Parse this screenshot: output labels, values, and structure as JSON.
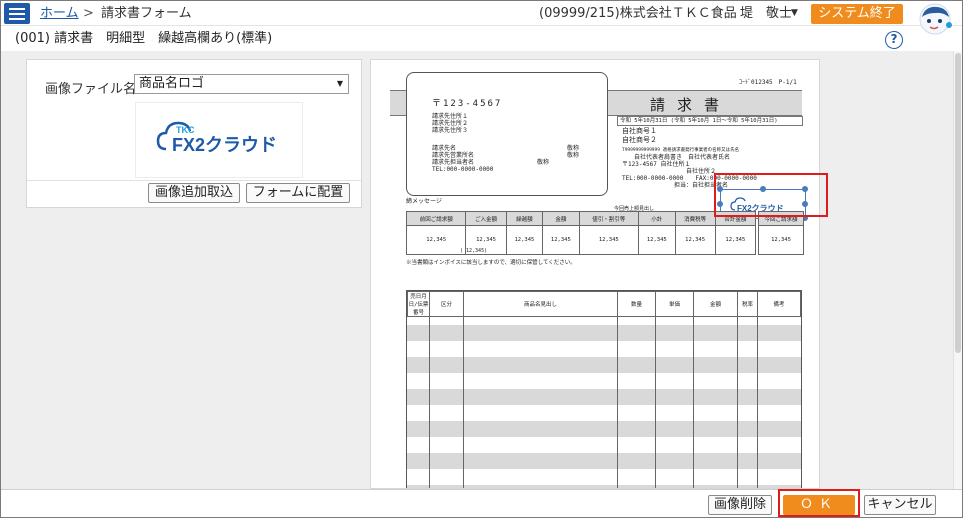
{
  "header": {
    "breadcrumb_home": "ホーム",
    "breadcrumb_sep": ">",
    "breadcrumb_page": "請求書フォーム",
    "company": "(09999/215)株式会社ＴＫＣ食品",
    "user": "堤　敬士",
    "exit_label": "システム終了"
  },
  "subheader": {
    "form_title": "(001) 請求書　明細型　繰越高欄あり(標準)",
    "help_label": "?"
  },
  "left_panel": {
    "image_label": "画像ファイル名",
    "image_select_value": "商品名ロゴ",
    "logo_top": "TKC",
    "logo_main": "FX2クラウド",
    "import_button": "画像追加取込",
    "place_button": "フォームに配置"
  },
  "preview": {
    "code": "ｺｰﾄﾞ012345　P-1/1",
    "doc_title": "請求書",
    "date_line": "令和 5年10月31日 (令和 5年10月 1日～令和 5年10月31日)",
    "zip": "〒123-4567",
    "bill_addr": [
      "請求先住所１",
      "請求先住所２",
      "請求先住所３"
    ],
    "bill_name": "請求先名",
    "bill_dept": "請求先営業所名",
    "bill_person": "請求先担当者名",
    "honorific": "敬称",
    "bill_tel": "TEL:000-0000-0000",
    "own_company": [
      "自社商号１",
      "自社商号２"
    ],
    "invoice_reg": "T9999999999999 適格請求書発行事業者の名称又は氏名",
    "own_rep": "自社代表者肩書き　自社代表者氏名",
    "own_addr1": "〒123-4567 自社住所１",
    "own_addr2": "自社住所２",
    "own_tel": "TEL:000-0000-0000　　FAX:000-0000-0000",
    "person_in_charge": "担当：自社担当者名",
    "message_label": "締メッセージ",
    "amount_headers": [
      "前回ご請求額",
      "ご入金額",
      "繰越額",
      "今回売上額見出し",
      "金額",
      "値引・割引等",
      "小計",
      "消費税等",
      "合計金額",
      "今回ご請求額"
    ],
    "amount_value": "12,345",
    "amount_sub": "( 12,345)",
    "invoice_note": "※当書類はインボイスに該当しますので、適切に保管してください。",
    "detail_headers": [
      "売日月日/伝票番号",
      "区分",
      "商品名見出し",
      "数量",
      "単価",
      "金額",
      "税率",
      "備考"
    ]
  },
  "footer": {
    "delete_label": "画像削除",
    "ok_label": "ＯＫ",
    "cancel_label": "キャンセル"
  },
  "colors": {
    "accent_blue": "#1e5aa8",
    "orange": "#f08c1e",
    "highlight_red": "#e01b1b"
  }
}
